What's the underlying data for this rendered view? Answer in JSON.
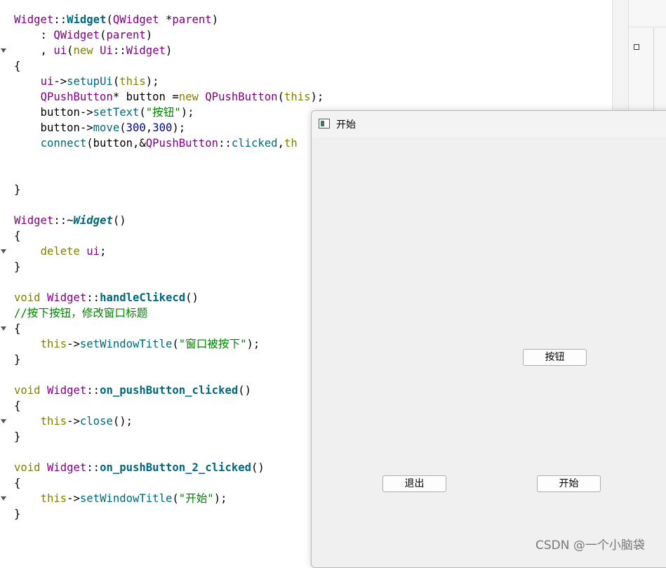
{
  "code": {
    "lines": [
      {
        "p": [
          [
            "t",
            "Widget"
          ],
          [
            "op",
            "::"
          ],
          [
            "fb",
            "Widget"
          ],
          [
            "op",
            "("
          ],
          [
            "t",
            "QWidget"
          ],
          [
            "op",
            " *"
          ],
          [
            "t",
            "parent"
          ],
          [
            "op",
            ")"
          ]
        ]
      },
      {
        "p": [
          [
            "op",
            "    : "
          ],
          [
            "t",
            "QWidget"
          ],
          [
            "op",
            "("
          ],
          [
            "t",
            "parent"
          ],
          [
            "op",
            ")"
          ]
        ]
      },
      {
        "p": [
          [
            "op",
            "    , "
          ],
          [
            "t",
            "ui"
          ],
          [
            "op",
            "("
          ],
          [
            "k",
            "new"
          ],
          [
            "op",
            " "
          ],
          [
            "t",
            "Ui"
          ],
          [
            "op",
            "::"
          ],
          [
            "t",
            "Widget"
          ],
          [
            "op",
            ")"
          ]
        ]
      },
      {
        "p": [
          [
            "op",
            "{"
          ]
        ]
      },
      {
        "p": [
          [
            "op",
            "    "
          ],
          [
            "t",
            "ui"
          ],
          [
            "op",
            "->"
          ],
          [
            "f",
            "setupUi"
          ],
          [
            "op",
            "("
          ],
          [
            "k",
            "this"
          ],
          [
            "op",
            ");"
          ]
        ]
      },
      {
        "p": [
          [
            "op",
            "    "
          ],
          [
            "t",
            "QPushButton"
          ],
          [
            "op",
            "* button ="
          ],
          [
            "k",
            "new"
          ],
          [
            "op",
            " "
          ],
          [
            "t",
            "QPushButton"
          ],
          [
            "op",
            "("
          ],
          [
            "k",
            "this"
          ],
          [
            "op",
            ");"
          ]
        ]
      },
      {
        "p": [
          [
            "op",
            "    button->"
          ],
          [
            "f",
            "setText"
          ],
          [
            "op",
            "("
          ],
          [
            "s",
            "\"按钮\""
          ],
          [
            "op",
            ");"
          ]
        ]
      },
      {
        "p": [
          [
            "op",
            "    button->"
          ],
          [
            "f",
            "move"
          ],
          [
            "op",
            "("
          ],
          [
            "n",
            "300"
          ],
          [
            "op",
            ","
          ],
          [
            "n",
            "300"
          ],
          [
            "op",
            ");"
          ]
        ]
      },
      {
        "p": [
          [
            "op",
            "    "
          ],
          [
            "f",
            "connect"
          ],
          [
            "op",
            "(button,&"
          ],
          [
            "t",
            "QPushButton"
          ],
          [
            "op",
            "::"
          ],
          [
            "f",
            "clicked"
          ],
          [
            "op",
            ","
          ],
          [
            "k",
            "th"
          ]
        ]
      },
      {
        "p": []
      },
      {
        "p": []
      },
      {
        "p": [
          [
            "op",
            "}"
          ]
        ]
      },
      {
        "p": []
      },
      {
        "p": [
          [
            "t",
            "Widget"
          ],
          [
            "op",
            "::~"
          ],
          [
            "fi",
            "Widget"
          ],
          [
            "op",
            "()"
          ]
        ]
      },
      {
        "p": [
          [
            "op",
            "{"
          ]
        ]
      },
      {
        "p": [
          [
            "op",
            "    "
          ],
          [
            "k",
            "delete"
          ],
          [
            "op",
            " "
          ],
          [
            "t",
            "ui"
          ],
          [
            "op",
            ";"
          ]
        ]
      },
      {
        "p": [
          [
            "op",
            "}"
          ]
        ]
      },
      {
        "p": []
      },
      {
        "p": [
          [
            "k",
            "void"
          ],
          [
            "op",
            " "
          ],
          [
            "t",
            "Widget"
          ],
          [
            "op",
            "::"
          ],
          [
            "fb",
            "handleClikecd"
          ],
          [
            "op",
            "()"
          ]
        ]
      },
      {
        "p": [
          [
            "c",
            "//按下按钮，修改窗口标题"
          ]
        ]
      },
      {
        "p": [
          [
            "op",
            "{"
          ]
        ]
      },
      {
        "p": [
          [
            "op",
            "    "
          ],
          [
            "k",
            "this"
          ],
          [
            "op",
            "->"
          ],
          [
            "f",
            "setWindowTitle"
          ],
          [
            "op",
            "("
          ],
          [
            "s",
            "\"窗口被按下\""
          ],
          [
            "op",
            ");"
          ]
        ]
      },
      {
        "p": [
          [
            "op",
            "}"
          ]
        ]
      },
      {
        "p": []
      },
      {
        "p": [
          [
            "k",
            "void"
          ],
          [
            "op",
            " "
          ],
          [
            "t",
            "Widget"
          ],
          [
            "op",
            "::"
          ],
          [
            "fb",
            "on_pushButton_clicked"
          ],
          [
            "op",
            "()"
          ]
        ]
      },
      {
        "p": [
          [
            "op",
            "{"
          ]
        ]
      },
      {
        "p": [
          [
            "op",
            "    "
          ],
          [
            "k",
            "this"
          ],
          [
            "op",
            "->"
          ],
          [
            "f",
            "close"
          ],
          [
            "op",
            "();"
          ]
        ]
      },
      {
        "p": [
          [
            "op",
            "}"
          ]
        ]
      },
      {
        "p": []
      },
      {
        "p": [
          [
            "k",
            "void"
          ],
          [
            "op",
            " "
          ],
          [
            "t",
            "Widget"
          ],
          [
            "op",
            "::"
          ],
          [
            "fb",
            "on_pushButton_2_clicked"
          ],
          [
            "op",
            "()"
          ]
        ]
      },
      {
        "p": [
          [
            "op",
            "{"
          ]
        ]
      },
      {
        "p": [
          [
            "op",
            "    "
          ],
          [
            "k",
            "this"
          ],
          [
            "op",
            "->"
          ],
          [
            "f",
            "setWindowTitle"
          ],
          [
            "op",
            "("
          ],
          [
            "s",
            "\"开始\""
          ],
          [
            "op",
            ");"
          ]
        ]
      },
      {
        "p": [
          [
            "op",
            "}"
          ]
        ]
      }
    ]
  },
  "app_window": {
    "title": "开始",
    "buttons": {
      "anniu": "按钮",
      "quit": "退出",
      "start": "开始"
    }
  },
  "watermark": "CSDN @一个小脑袋"
}
